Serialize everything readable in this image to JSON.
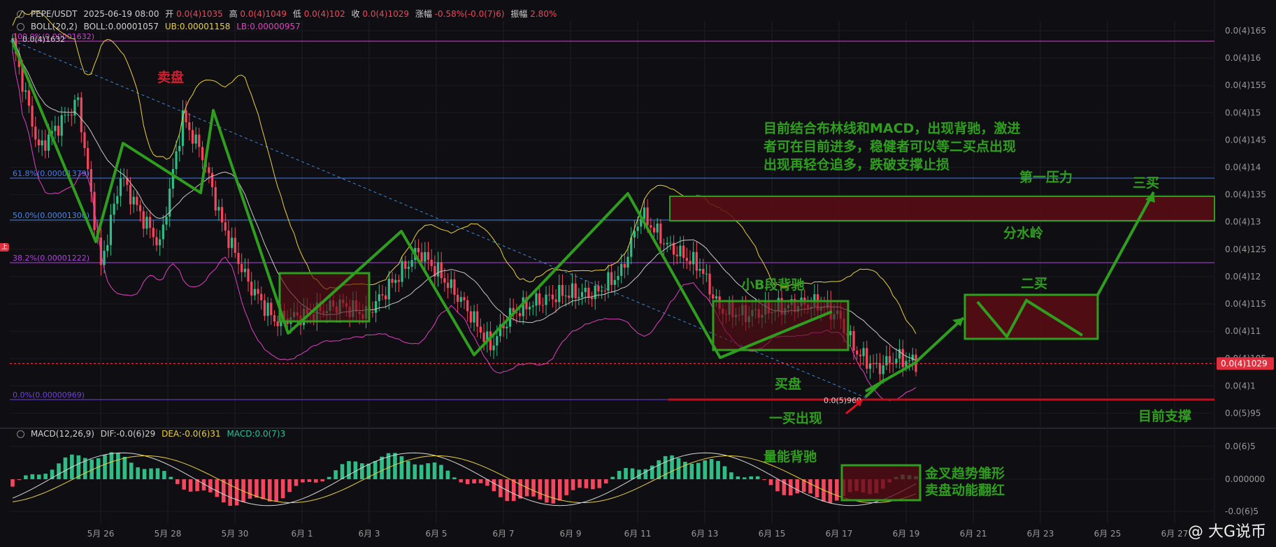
{
  "header": {
    "symbol": "PEPE/USDT",
    "time": "2025-06-19 08:00",
    "open_label": "开",
    "open": "0.0(4)1035",
    "high_label": "高",
    "high": "0.0(4)1049",
    "low_label": "低",
    "low": "0.0(4)102",
    "close_label": "收",
    "close": "0.0(4)1029",
    "change_label": "涨幅",
    "change": "-0.58%(-0.0(7)6)",
    "amp_label": "振幅",
    "amp": "2.80%"
  },
  "boll": {
    "name": "BOLL(20,2)",
    "mid": "BOLL:0.00001057",
    "ub": "UB:0.00001158",
    "lb": "LB:0.00000957"
  },
  "macd": {
    "name": "MACD(12,26,9)",
    "dif": "DIF:-0.0(6)29",
    "dea": "DEA:-0.0(6)31",
    "macd": "MACD:0.0(7)3"
  },
  "watermark": "@ 大G说币",
  "side_tag": "上",
  "chart_data": {
    "type": "candlestick",
    "x_ticks": [
      "5月 26",
      "5月 28",
      "5月 30",
      "6月 1",
      "6月 3",
      "6月 5",
      "6月 7",
      "6月 9",
      "6月 11",
      "6月 13",
      "6月 15",
      "6月 17",
      "6月 19",
      "6月 21",
      "6月 23",
      "6月 25",
      "6月 27"
    ],
    "y_ticks": [
      "0.0(4)165",
      "0.0(4)16",
      "0.0(4)155",
      "0.0(4)15",
      "0.0(4)145",
      "0.0(4)14",
      "0.0(4)135",
      "0.0(4)13",
      "0.0(4)125",
      "0.0(4)12",
      "0.0(4)115",
      "0.0(4)11",
      "0.0(4)105",
      "0.0(4)1",
      "0.0(5)95"
    ],
    "y_range": [
      9.3e-06,
      1.66e-05
    ],
    "last_price_label": "0.0(4)1029",
    "last_price": 1.029e-05,
    "fib_levels": [
      {
        "label": "100.0%(0.00001632)",
        "value": 1.632e-05,
        "color": "#d040d0"
      },
      {
        "label": "61.8%(0.00001379)",
        "value": 1.379e-05,
        "color": "#4a7ae8"
      },
      {
        "label": "50.0%(0.00001300)",
        "value": 1.3e-05,
        "color": "#4a8ae8"
      },
      {
        "label": "38.2%(0.00001222)",
        "value": 1.222e-05,
        "color": "#b040e0"
      },
      {
        "label": "0.0%(0.00000969)",
        "value": 9.69e-06,
        "color": "#7040e0"
      }
    ],
    "top_price_label": "0.0(4)1632",
    "low_price_label": "0.0(5)969",
    "macd_y_ticks": [
      "0.0(6)5",
      "0.000000",
      "-0.0(6)5"
    ],
    "annotations": {
      "sell": "卖盘",
      "buy": "买盘",
      "first_buy": "一买出现",
      "second_buy": "二买",
      "third_buy": "三买",
      "pressure": "第一压力",
      "divide": "分水岭",
      "support": "目前支撑",
      "small_b": "小B段背驰",
      "volume_div": "量能背驰",
      "main_text": [
        "目前结合布林线和MACD，出现背驰，激进",
        "者可在目前进多，稳健者可以等二买点出现",
        "出现再轻仓追多，跌破支撑止损"
      ],
      "golden_cross": [
        "金叉趋势雏形",
        "卖盘动能翻红"
      ]
    },
    "colors": {
      "up": "#2ebd85",
      "down": "#f6465d",
      "boll_ub": "#e8d040",
      "boll_mid": "#c8c8c8",
      "boll_lb": "#e040c0",
      "annot": "#2f9e1f",
      "box": "#5a0c14"
    }
  }
}
